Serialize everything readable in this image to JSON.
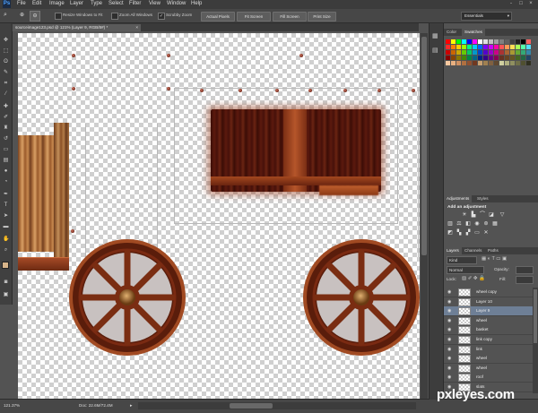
{
  "app": {
    "logo": "Ps"
  },
  "menu": [
    "File",
    "Edit",
    "Image",
    "Layer",
    "Type",
    "Select",
    "Filter",
    "View",
    "Window",
    "Help"
  ],
  "window_controls": [
    "-",
    "□",
    "×"
  ],
  "options_bar": {
    "resize_windows_label": "Resize Windows to Fit",
    "zoom_all_label": "Zoom All Windows",
    "scrubby_zoom_label": "Scrubby Zoom",
    "actual_pixels": "Actual Pixels",
    "fit_screen": "Fit Screen",
    "fill_screen": "Fill Screen",
    "print_size": "Print Size",
    "workspace": "Essentials"
  },
  "document_tab": {
    "title": "sourceimage123.psd @ 121% (Layer 9, RGB/8#) *",
    "close": "×"
  },
  "status_bar": {
    "zoom": "121.37%",
    "doc": "Doc: 22.6M/72.4M"
  },
  "color_panel": {
    "tabs": [
      "Color",
      "Swatches"
    ],
    "active_tab": "Swatches",
    "swatch_colors": [
      "#ff0000",
      "#ffff00",
      "#00ff00",
      "#00ffff",
      "#0000ff",
      "#ff00ff",
      "#ffffff",
      "#e0e0e0",
      "#c0c0c0",
      "#a0a0a0",
      "#808080",
      "#606060",
      "#404040",
      "#202020",
      "#000000",
      "#ff6060",
      "#ff2a2a",
      "#ff7f00",
      "#ffcc00",
      "#99ff00",
      "#00ff7f",
      "#00ccff",
      "#0066ff",
      "#7f00ff",
      "#cc00ff",
      "#ff00aa",
      "#ff5555",
      "#ff9955",
      "#ffdd55",
      "#aaff55",
      "#55ffaa",
      "#55ddff",
      "#cc0000",
      "#cc6600",
      "#ccaa00",
      "#66cc00",
      "#00cc66",
      "#0099cc",
      "#0044cc",
      "#5500cc",
      "#9900cc",
      "#cc0088",
      "#aa3333",
      "#aa6633",
      "#aa9933",
      "#66aa33",
      "#33aa77",
      "#3388aa",
      "#880000",
      "#884400",
      "#887700",
      "#448800",
      "#008844",
      "#006688",
      "#002288",
      "#330088",
      "#660088",
      "#880055",
      "#663322",
      "#664422",
      "#665522",
      "#446622",
      "#226644",
      "#224466",
      "#f7c8a0",
      "#e8b080",
      "#d09060",
      "#b07040",
      "#905030",
      "#703820",
      "#c8a070",
      "#a08050",
      "#806040",
      "#604830",
      "#d0d0a0",
      "#b0b080",
      "#909060",
      "#707048",
      "#505030",
      "#303020"
    ]
  },
  "adjustments_panel": {
    "tabs": [
      "Adjustments",
      "Styles"
    ],
    "active_tab": "Adjustments",
    "heading": "Add an adjustment",
    "row1_icons": [
      "brightness-icon",
      "levels-icon",
      "curves-icon",
      "exposure-icon",
      "vibrance-icon"
    ],
    "row2_icons": [
      "hue-icon",
      "balance-icon",
      "bw-icon",
      "photo-filter-icon",
      "mixer-icon",
      "lookup-icon"
    ],
    "row3_icons": [
      "invert-icon",
      "posterize-icon",
      "threshold-icon",
      "gradient-map-icon",
      "selective-color-icon"
    ]
  },
  "layers_panel": {
    "tabs": [
      "Layers",
      "Channels",
      "Paths"
    ],
    "active_tab": "Layers",
    "filter_kind": "Kind",
    "blend_mode": "Normal",
    "opacity_label": "Opacity:",
    "lock_label": "Lock:",
    "fill_label": "Fill:",
    "layers": [
      {
        "name": "wheel copy",
        "selected": false
      },
      {
        "name": "Layer 10",
        "selected": false
      },
      {
        "name": "Layer 9",
        "selected": true
      },
      {
        "name": "wheel",
        "selected": false
      },
      {
        "name": "basket",
        "selected": false
      },
      {
        "name": "link copy",
        "selected": false
      },
      {
        "name": "link",
        "selected": false
      },
      {
        "name": "wheel",
        "selected": false
      },
      {
        "name": "wheel",
        "selected": false
      },
      {
        "name": "roof",
        "selected": false
      },
      {
        "name": "slats",
        "selected": false
      }
    ]
  },
  "watermark": "pxleyes.com"
}
